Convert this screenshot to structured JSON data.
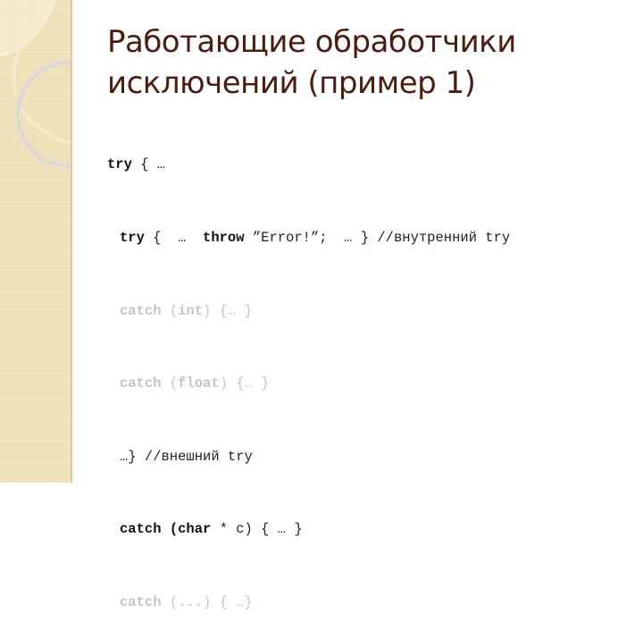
{
  "slide": {
    "title_line1": "Работающие обработчики",
    "title_line2": "исключений (пример 1)",
    "colors": {
      "title": "#4a1d12",
      "side_panel": "#efe0b4",
      "code_active": "#111111",
      "code_dimmed": "#c4c4c4"
    }
  },
  "code": {
    "line1": {
      "kw": "try",
      "rest": " { …"
    },
    "line2": {
      "kw1": "try",
      "mid1": " {  …  ",
      "kw2": "throw",
      "rest": " ”Error!”;  … } //внутренний try"
    },
    "line3": {
      "kw": "catch",
      "mid": " (",
      "kw2": "int",
      "rest": ") {… }"
    },
    "line4": {
      "kw": "catch",
      "mid": " (",
      "kw2": "float",
      "rest": ") {… }"
    },
    "line5": {
      "text": "…} //внешний try"
    },
    "line6": {
      "kw": "catch",
      "mid": " (",
      "kw2": "char",
      "rest": " * c) { … }"
    },
    "line7": {
      "kw": "catch",
      "rest": " (...) { …}"
    }
  }
}
